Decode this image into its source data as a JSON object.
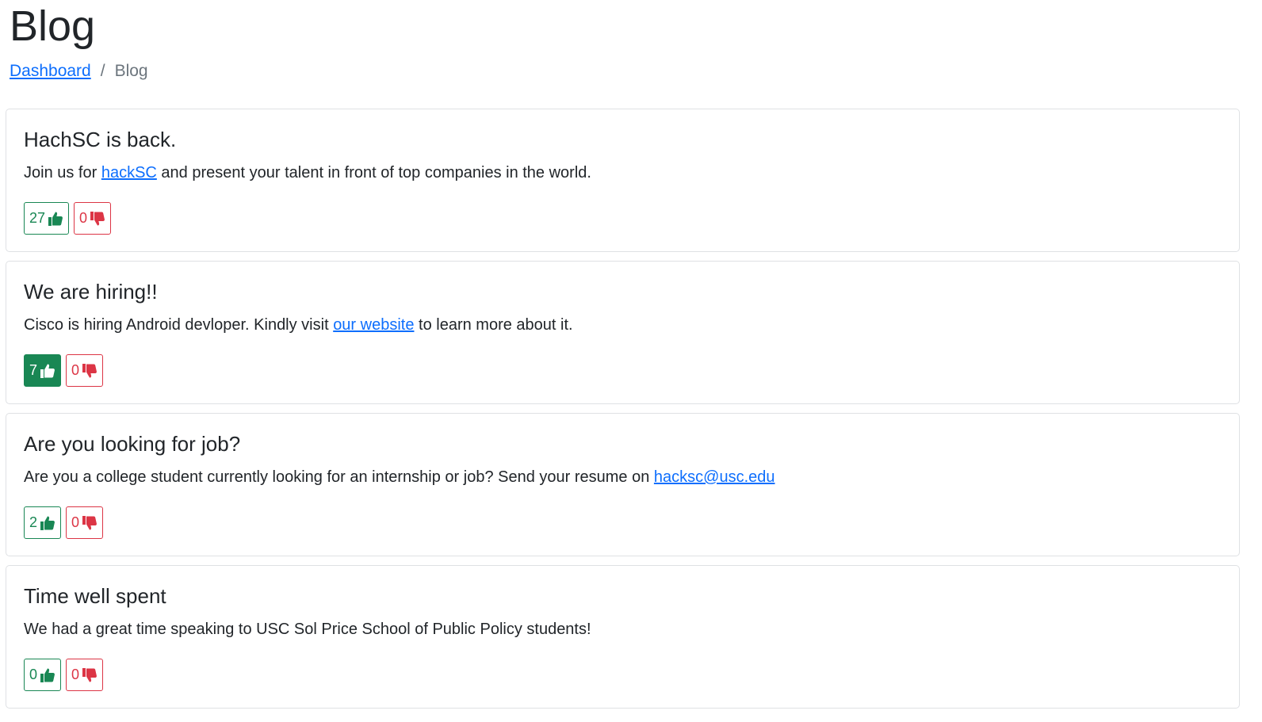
{
  "page": {
    "title": "Blog"
  },
  "breadcrumb": {
    "home_label": "Dashboard",
    "separator": "/",
    "current_label": "Blog"
  },
  "colors": {
    "like": "#198754",
    "dislike": "#dc3545",
    "link": "#0d6efd"
  },
  "posts": [
    {
      "title": "HachSC is back.",
      "text_before": "Join us for ",
      "link_text": "hackSC",
      "text_after": " and present your talent in front of top companies in the world.",
      "likes": "27",
      "dislikes": "0",
      "liked": false
    },
    {
      "title": "We are hiring!!",
      "text_before": "Cisco is hiring Android devloper. Kindly visit ",
      "link_text": "our website",
      "text_after": " to learn more about it.",
      "likes": "7",
      "dislikes": "0",
      "liked": true
    },
    {
      "title": "Are you looking for job?",
      "text_before": "Are you a college student currently looking for an internship or job? Send your resume on ",
      "link_text": "hacksc@usc.edu",
      "text_after": "",
      "likes": "2",
      "dislikes": "0",
      "liked": false
    },
    {
      "title": "Time well spent",
      "text_before": "We had a great time speaking to USC Sol Price School of Public Policy students!",
      "link_text": "",
      "text_after": "",
      "likes": "0",
      "dislikes": "0",
      "liked": false
    }
  ],
  "icons": {
    "like": "thumbs-up-icon",
    "dislike": "thumbs-down-icon"
  }
}
